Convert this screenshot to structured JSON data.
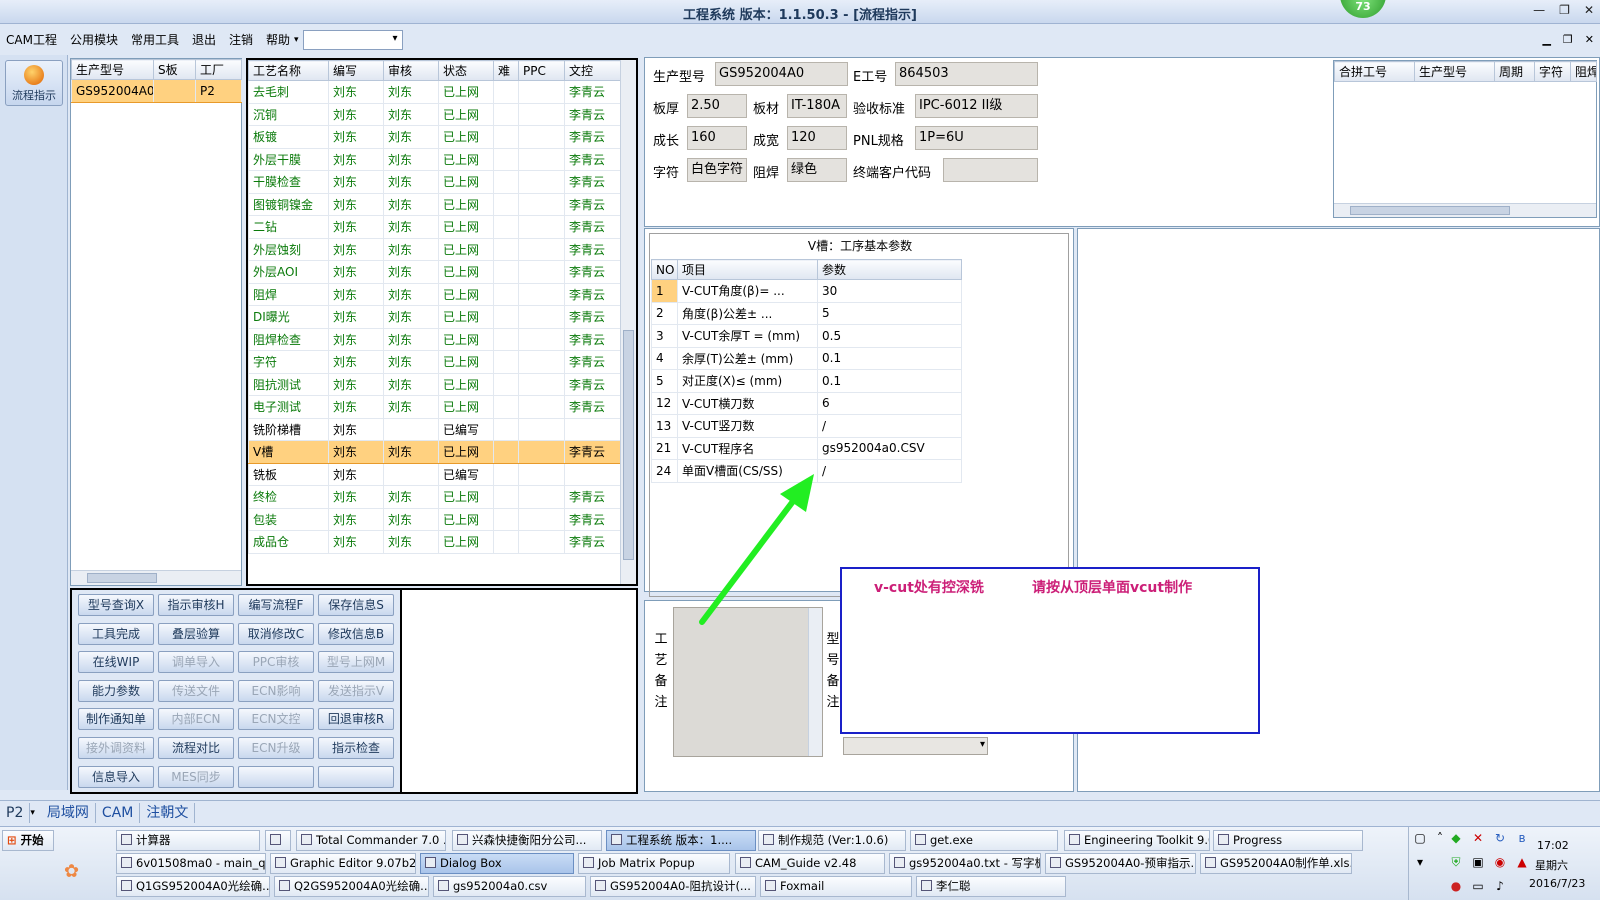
{
  "window": {
    "title": "工程系统   版本：1.1.50.3 - [流程指示]",
    "badge": "73"
  },
  "menu": [
    "CAM工程",
    "公用模块",
    "常用工具",
    "退出",
    "注销",
    "帮助"
  ],
  "menu_dropdown_arrow": "▾",
  "rail": {
    "flow_label": "流程指示"
  },
  "model_grid": {
    "headers": [
      "生产型号",
      "S板",
      "工厂"
    ],
    "rows": [
      [
        "GS952004A0",
        "",
        "P2"
      ]
    ]
  },
  "process_grid": {
    "headers": [
      "工艺名称",
      "编写",
      "审核",
      "状态",
      "难",
      "PPC",
      "文控"
    ],
    "rows": [
      [
        "去毛刺",
        "刘东",
        "刘东",
        "已上网",
        "",
        "",
        "李青云"
      ],
      [
        "沉铜",
        "刘东",
        "刘东",
        "已上网",
        "",
        "",
        "李青云"
      ],
      [
        "板镀",
        "刘东",
        "刘东",
        "已上网",
        "",
        "",
        "李青云"
      ],
      [
        "外层干膜",
        "刘东",
        "刘东",
        "已上网",
        "",
        "",
        "李青云"
      ],
      [
        "干膜检查",
        "刘东",
        "刘东",
        "已上网",
        "",
        "",
        "李青云"
      ],
      [
        "图镀铜镍金",
        "刘东",
        "刘东",
        "已上网",
        "",
        "",
        "李青云"
      ],
      [
        "二钻",
        "刘东",
        "刘东",
        "已上网",
        "",
        "",
        "李青云"
      ],
      [
        "外层蚀刻",
        "刘东",
        "刘东",
        "已上网",
        "",
        "",
        "李青云"
      ],
      [
        "外层AOI",
        "刘东",
        "刘东",
        "已上网",
        "",
        "",
        "李青云"
      ],
      [
        "阻焊",
        "刘东",
        "刘东",
        "已上网",
        "",
        "",
        "李青云"
      ],
      [
        "DI曝光",
        "刘东",
        "刘东",
        "已上网",
        "",
        "",
        "李青云"
      ],
      [
        "阻焊检查",
        "刘东",
        "刘东",
        "已上网",
        "",
        "",
        "李青云"
      ],
      [
        "字符",
        "刘东",
        "刘东",
        "已上网",
        "",
        "",
        "李青云"
      ],
      [
        "阻抗测试",
        "刘东",
        "刘东",
        "已上网",
        "",
        "",
        "李青云"
      ],
      [
        "电子测试",
        "刘东",
        "刘东",
        "已上网",
        "",
        "",
        "李青云"
      ],
      [
        "铣阶梯槽",
        "刘东",
        "",
        "已编写",
        "",
        "",
        ""
      ],
      [
        "V槽",
        "刘东",
        "刘东",
        "已上网",
        "",
        "",
        "李青云"
      ],
      [
        "铣板",
        "刘东",
        "",
        "已编写",
        "",
        "",
        ""
      ],
      [
        "终检",
        "刘东",
        "刘东",
        "已上网",
        "",
        "",
        "李青云"
      ],
      [
        "包装",
        "刘东",
        "刘东",
        "已上网",
        "",
        "",
        "李青云"
      ],
      [
        "成品仓",
        "刘东",
        "刘东",
        "已上网",
        "",
        "",
        "李青云"
      ]
    ],
    "selected_index": 16
  },
  "actions": [
    [
      "型号查询X",
      "指示审核H",
      "编写流程F",
      "保存信息S"
    ],
    [
      "工具完成",
      "叠层验算",
      "取消修改C",
      "修改信息B"
    ],
    [
      "在线WIP",
      "调单导入",
      "PPC审核",
      "型号上网M"
    ],
    [
      "能力参数",
      "传送文件",
      "ECN影响",
      "发送指示V"
    ],
    [
      "制作通知单",
      "内部ECN",
      "ECN文控",
      "回退审核R"
    ],
    [
      "接外调资料",
      "流程对比",
      "ECN升级",
      "指示检查"
    ],
    [
      "信息导入",
      "MES同步",
      "",
      ""
    ]
  ],
  "disabled_actions": [
    "调单导入",
    "PPC审核",
    "型号上网M",
    "传送文件",
    "ECN影响",
    "发送指示V",
    "内部ECN",
    "ECN文控",
    "接外调资料",
    "ECN升级",
    "MES同步"
  ],
  "info": {
    "model_label": "生产型号",
    "model_value": "GS952004A0",
    "e_label": "E工号",
    "e_value": "864503",
    "thick_label": "板厚",
    "thick_value": "2.50",
    "material_label": "板材",
    "material_value": "IT-180A",
    "accept_label": "验收标准",
    "accept_value": "IPC-6012 II级",
    "len_label": "成长",
    "len_value": "160",
    "width_label": "成宽",
    "width_value": "120",
    "pnl_label": "PNL规格",
    "pnl_value": "1P=6U",
    "char_label": "字符",
    "char_value": "白色字符",
    "mask_label": "阻焊",
    "mask_value": "绿色",
    "cust_label": "终端客户代码",
    "cust_value": ""
  },
  "combine_grid": {
    "headers": [
      "合拼工号",
      "生产型号",
      "周期",
      "字符",
      "阻焊"
    ]
  },
  "params": {
    "title": "V槽：工序基本参数",
    "headers": [
      "NO",
      "项目",
      "参数"
    ],
    "rows": [
      [
        "1",
        "V-CUT角度(β)=  ...",
        "30"
      ],
      [
        "2",
        "角度(β)公差±  ...",
        "5"
      ],
      [
        "3",
        "V-CUT余厚T =  (mm)",
        "0.5"
      ],
      [
        "4",
        "余厚(T)公差±  (mm)",
        "0.1"
      ],
      [
        "5",
        "对正度(X)≤ (mm)",
        "0.1"
      ],
      [
        "12",
        "V-CUT横刀数",
        "6"
      ],
      [
        "13",
        "V-CUT竖刀数",
        "/"
      ],
      [
        "21",
        "V-CUT程序名",
        "gs952004a0.CSV"
      ],
      [
        "24",
        "单面V槽面(CS/SS)",
        "/"
      ]
    ]
  },
  "remarks": {
    "process_label": [
      "工",
      "艺",
      "备",
      "注"
    ],
    "model_label": [
      "型",
      "号",
      "备",
      "注"
    ]
  },
  "notice": {
    "text1": "v-cut处有控深铣",
    "text2": "请按从顶层单面vcut制作"
  },
  "status_tabs": [
    "P2",
    "局域网",
    "CAM",
    "注朝文"
  ],
  "taskbar": {
    "start": "开始",
    "row1": [
      "计算器",
      "",
      "Total Commander 7.0 ...",
      "兴森快捷衡阳分公司...",
      "工程系统   版本：1....",
      "制作规范 (Ver:1.0.6)",
      "get.exe",
      "Engineering Toolkit 9.0...",
      "Progress"
    ],
    "row2": [
      "6v01508ma0 - main_qa",
      "Graphic Editor 9.07b2 (...",
      "Dialog Box",
      "Job Matrix Popup",
      "CAM_Guide v2.48",
      "gs952004a0.txt - 写字板",
      "GS952004A0-预审指示...",
      "GS952004A0制作单.xls..."
    ],
    "row3": [
      "Q1GS952004A0光绘确...",
      "Q2GS952004A0光绘确...",
      "gs952004a0.csv",
      "GS952004A0-阻抗设计(...",
      "Foxmail",
      "李仁聪"
    ],
    "clock": "17:02",
    "weekday": "星期六",
    "date": "2016/7/23"
  },
  "colors": {
    "notice_border": "#1a20c8",
    "notice_text": "#cc1f78",
    "selection": "#ffd180",
    "status_text": "#0a7a0a",
    "arrow": "#22ee22"
  }
}
